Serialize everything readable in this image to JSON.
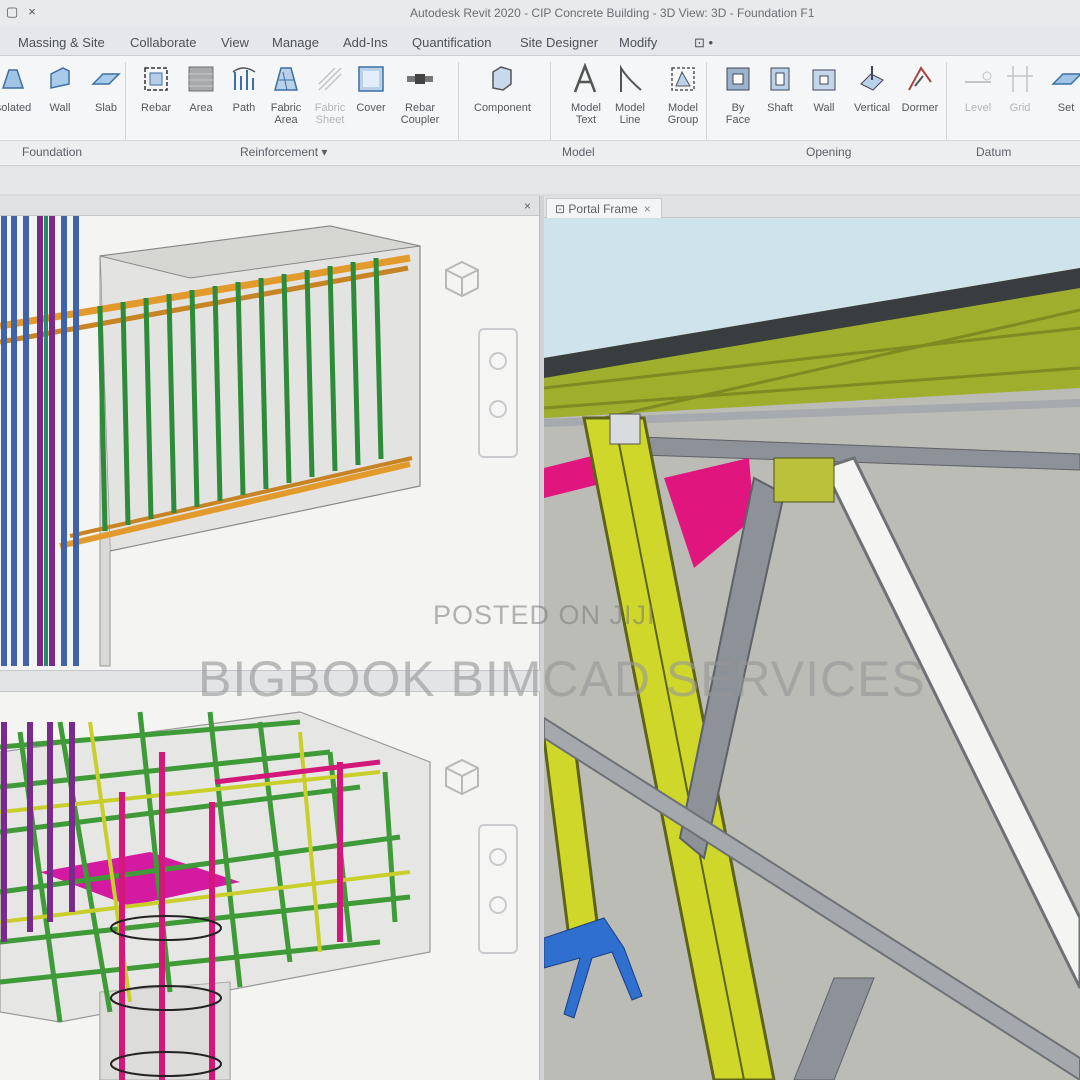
{
  "window": {
    "title": "Autodesk Revit 2020 - CIP Concrete Building - 3D View: 3D - Foundation F1",
    "qat_icons": [
      "revit-logo-icon",
      "close-icon"
    ]
  },
  "ribbon": {
    "tabs": [
      "Massing & Site",
      "Collaborate",
      "View",
      "Manage",
      "Add-Ins",
      "Quantification",
      "Site Designer",
      "Modify",
      "⊡ •"
    ],
    "tools": [
      {
        "label": "Isolated",
        "icon": "isolated-footing-icon",
        "enabled": true
      },
      {
        "label": "Wall",
        "icon": "wall-foundation-icon",
        "enabled": true
      },
      {
        "label": "Slab",
        "icon": "slab-icon",
        "enabled": true
      },
      {
        "label": "Rebar",
        "icon": "rebar-icon",
        "enabled": true
      },
      {
        "label": "Area",
        "icon": "area-reinforcement-icon",
        "enabled": true
      },
      {
        "label": "Path",
        "icon": "path-reinforcement-icon",
        "enabled": true
      },
      {
        "label": "Fabric\nArea",
        "icon": "fabric-area-icon",
        "enabled": true
      },
      {
        "label": "Fabric\nSheet",
        "icon": "fabric-sheet-icon",
        "enabled": false
      },
      {
        "label": "Cover",
        "icon": "cover-icon",
        "enabled": true
      },
      {
        "label": "Rebar\nCoupler",
        "icon": "rebar-coupler-icon",
        "enabled": true
      },
      {
        "label": "Component",
        "icon": "component-icon",
        "enabled": true
      },
      {
        "label": "Model\nText",
        "icon": "model-text-icon",
        "enabled": true
      },
      {
        "label": "Model\nLine",
        "icon": "model-line-icon",
        "enabled": true
      },
      {
        "label": "Model\nGroup",
        "icon": "model-group-icon",
        "enabled": true
      },
      {
        "label": "By\nFace",
        "icon": "opening-by-face-icon",
        "enabled": true
      },
      {
        "label": "Shaft",
        "icon": "shaft-icon",
        "enabled": true
      },
      {
        "label": "Wall",
        "icon": "wall-opening-icon",
        "enabled": true
      },
      {
        "label": "Vertical",
        "icon": "vertical-opening-icon",
        "enabled": true
      },
      {
        "label": "Dormer",
        "icon": "dormer-icon",
        "enabled": true
      },
      {
        "label": "Level",
        "icon": "level-icon",
        "enabled": false
      },
      {
        "label": "Grid",
        "icon": "grid-icon",
        "enabled": false
      },
      {
        "label": "Set",
        "icon": "set-workplane-icon",
        "enabled": true
      }
    ],
    "panels": [
      "Foundation",
      "Reinforcement ▾",
      "Model",
      "Opening",
      "Datum"
    ]
  },
  "views": {
    "right_tab": "Portal Frame",
    "right_tab_close": "×",
    "close_glyph": "×"
  },
  "watermarks": {
    "small": "POSTED ON JIJI",
    "large": "BIGBOOK BIMCAD SERVICES"
  },
  "colors": {
    "rebar_green": "#2e8b3a",
    "rebar_orange": "#e39a2c",
    "rebar_purple": "#7a2a8a",
    "rebar_magenta": "#d4177a",
    "steel_yellow": "#cfd82a",
    "steel_gray": "#8d9198",
    "sky": "#cfe3ea"
  }
}
